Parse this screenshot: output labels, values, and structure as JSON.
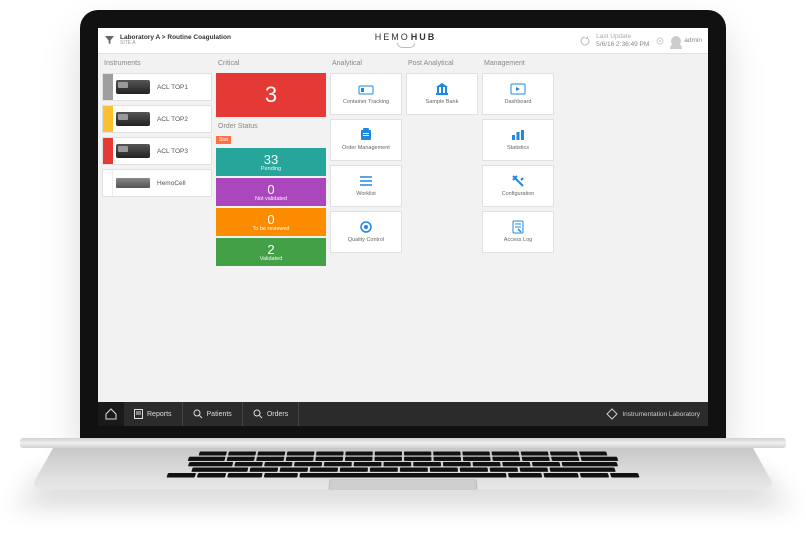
{
  "header": {
    "breadcrumb": "Laboratory A > Routine Coagulation",
    "breadcrumb_sub": "SITE A",
    "logo_top": "HEMO",
    "logo_bottom": "HUB",
    "last_update_label": "Last Update",
    "last_update_value": "5/6/16 2:36:49 PM",
    "user_name": "admin"
  },
  "instruments": {
    "header": "Instruments",
    "items": [
      {
        "color": "#9e9e9e",
        "label": "ACL TOP1",
        "type": "top"
      },
      {
        "color": "#fbc02d",
        "label": "ACL TOP2",
        "type": "top"
      },
      {
        "color": "#e53935",
        "label": "ACL TOP3",
        "type": "top"
      },
      {
        "color": "#ffffff",
        "label": "HemoCell",
        "type": "cell"
      }
    ]
  },
  "critical": {
    "header": "Critical",
    "value": "3"
  },
  "order_status": {
    "header": "Order Status",
    "tag": "Stat",
    "items": [
      {
        "value": "33",
        "label": "Pending",
        "color": "#26a69a"
      },
      {
        "value": "0",
        "label": "Not validated",
        "color": "#ab47bc"
      },
      {
        "value": "0",
        "label": "To be reviewed",
        "color": "#fb8c00"
      },
      {
        "value": "2",
        "label": "Validated",
        "color": "#43a047"
      }
    ]
  },
  "analytical": {
    "header": "Analytical",
    "tiles": [
      {
        "icon": "container-icon",
        "label": "Container Tracking"
      },
      {
        "icon": "order-mgmt-icon",
        "label": "Order Management"
      },
      {
        "icon": "worklist-icon",
        "label": "Worklist"
      },
      {
        "icon": "qc-icon",
        "label": "Quality Control"
      }
    ]
  },
  "post_analytical": {
    "header": "Post Analytical",
    "tiles": [
      {
        "icon": "bank-icon",
        "label": "Sample Bank"
      }
    ]
  },
  "management": {
    "header": "Management",
    "tiles": [
      {
        "icon": "dashboard-icon",
        "label": "Dashboard"
      },
      {
        "icon": "statistics-icon",
        "label": "Statistics"
      },
      {
        "icon": "configuration-icon",
        "label": "Configuration"
      },
      {
        "icon": "access-log-icon",
        "label": "Access Log"
      }
    ]
  },
  "bottomnav": {
    "home": "⌂",
    "reports": "Reports",
    "patients": "Patients",
    "orders": "Orders",
    "brand": "Instrumentation Laboratory"
  }
}
